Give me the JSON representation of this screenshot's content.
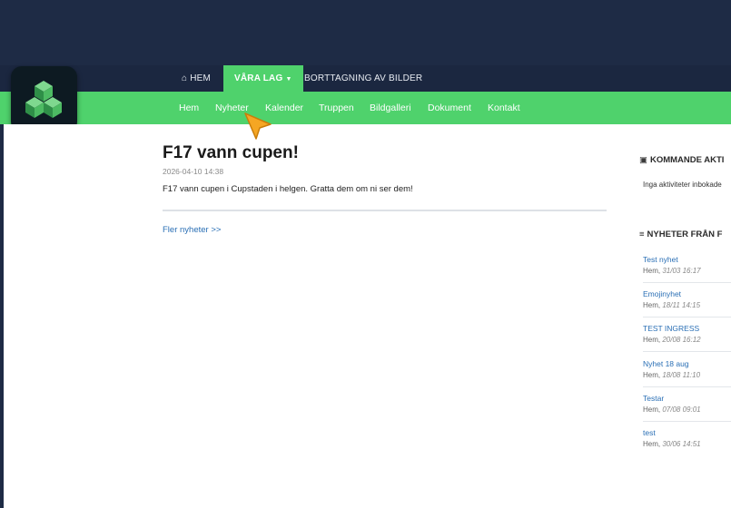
{
  "topnav": {
    "home": "HEM",
    "teams": "VÅRA LAG",
    "removal": "BORTTAGNING AV BILDER"
  },
  "subnav": {
    "items": [
      "Hem",
      "Nyheter",
      "Kalender",
      "Truppen",
      "Bildgalleri",
      "Dokument",
      "Kontakt"
    ]
  },
  "article": {
    "title": "F17 vann cupen!",
    "date": "2026-04-10 14:38",
    "body": "F17 vann cupen i Cupstaden i helgen. Gratta dem om ni ser dem!",
    "more_link": "Fler nyheter >>"
  },
  "sidebar": {
    "upcoming_heading": "KOMMANDE AKTI",
    "upcoming_empty": "Inga aktiviteter inbokade",
    "news_heading": "NYHETER FRÅN F",
    "news": [
      {
        "title": "Test nyhet",
        "source": "Hem,",
        "date": "31/03 16:17"
      },
      {
        "title": "Emojinyhet",
        "source": "Hem,",
        "date": "18/11 14:15"
      },
      {
        "title": "TEST INGRESS",
        "source": "Hem,",
        "date": "20/08 16:12"
      },
      {
        "title": "Nyhet 18 aug",
        "source": "Hem,",
        "date": "18/08 11:10"
      },
      {
        "title": "Testar",
        "source": "Hem,",
        "date": "07/08 09:01"
      },
      {
        "title": "test",
        "source": "Hem,",
        "date": "30/06 14:51"
      }
    ]
  },
  "colors": {
    "accent_green": "#4fd26c",
    "nav_dark": "#1b2740",
    "link_blue": "#2a6fb5",
    "cursor_orange": "#f5a623"
  },
  "icons": {
    "home": "home-icon",
    "calendar": "calendar-icon",
    "list": "list-icon",
    "app": "cubes-app-icon",
    "cursor": "pointer-cursor"
  }
}
